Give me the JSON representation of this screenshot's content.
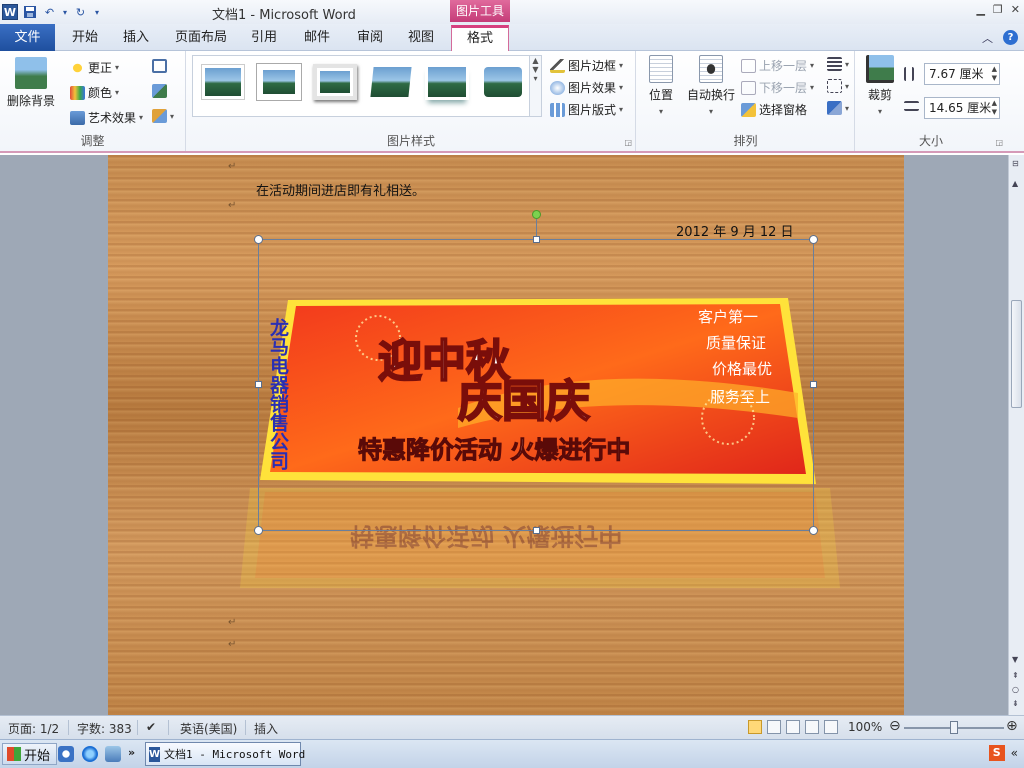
{
  "window": {
    "title": "文档1 - Microsoft Word",
    "context_tab_group": "图片工具"
  },
  "tabs": [
    "文件",
    "开始",
    "插入",
    "页面布局",
    "引用",
    "邮件",
    "审阅",
    "视图",
    "格式"
  ],
  "active_tab": "格式",
  "ribbon": {
    "adjust": {
      "label": "调整",
      "remove_background": "删除背景",
      "corrections": "更正",
      "color": "颜色",
      "artistic_effects": "艺术效果"
    },
    "picture_styles": {
      "label": "图片样式",
      "border": "图片边框",
      "effects": "图片效果",
      "layout": "图片版式"
    },
    "arrange": {
      "label": "排列",
      "position": "位置",
      "wrap_text": "自动换行",
      "bring_forward": "上移一层",
      "send_backward": "下移一层",
      "selection_pane": "选择窗格"
    },
    "size": {
      "label": "大小",
      "crop": "裁剪",
      "height": "7.67 厘米",
      "width": "14.65 厘米"
    }
  },
  "document": {
    "line1": "在活动期间进店即有礼相送。",
    "date": "2012 年 9 月 12 日",
    "banner": {
      "headline_top": "迎中秋",
      "headline_bottom": "庆国庆",
      "company": "龙马电器销售公司",
      "promo": "特惠降价活动  火爆进行中",
      "side_lines": [
        "客户第一",
        "质量保证",
        "价格最优",
        "服务至上"
      ]
    }
  },
  "status_bar": {
    "page": "页面: 1/2",
    "words": "字数: 383",
    "language": "英语(美国)",
    "mode": "插入",
    "zoom": "100%"
  },
  "taskbar": {
    "start": "开始",
    "task": "文档1 - Microsoft Word"
  },
  "colors": {
    "file_tab": "#2b5fb4",
    "context_tab": "#d6407f",
    "banner_red": "#e23b1c",
    "banner_yellow": "#ffe23a"
  }
}
